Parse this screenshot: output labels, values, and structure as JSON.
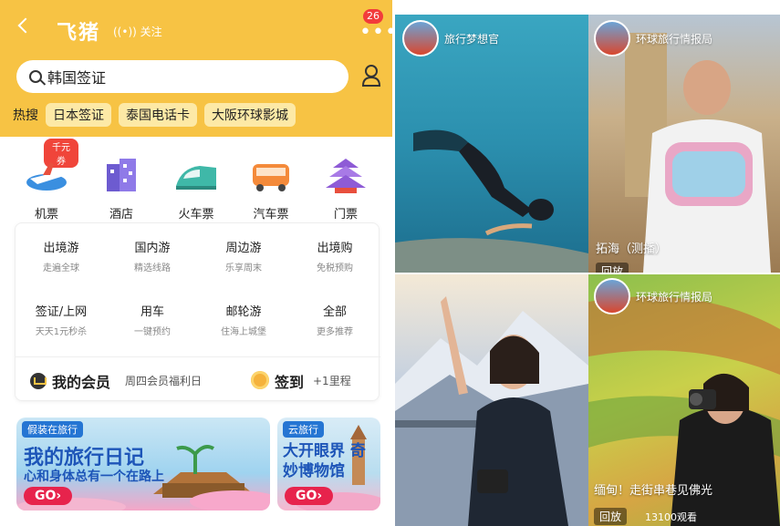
{
  "app": {
    "brand": "飞猪",
    "follow": "关注",
    "badge": "26",
    "more": "•••",
    "search_value": "韩国签证",
    "hot_label": "热搜",
    "hot_tags": [
      "日本签证",
      "泰国电话卡",
      "大阪环球影城"
    ]
  },
  "categories": [
    {
      "label": "机票",
      "promo": "千元券",
      "icon": "plane-icon"
    },
    {
      "label": "酒店",
      "icon": "hotel-icon"
    },
    {
      "label": "火车票",
      "icon": "train-icon"
    },
    {
      "label": "汽车票",
      "icon": "bus-icon"
    },
    {
      "label": "门票",
      "icon": "temple-icon"
    }
  ],
  "grid": [
    {
      "title": "出境游",
      "sub": "走遍全球"
    },
    {
      "title": "国内游",
      "sub": "精选线路"
    },
    {
      "title": "周边游",
      "sub": "乐享周末"
    },
    {
      "title": "出境购",
      "sub": "免税预购"
    },
    {
      "title": "签证/上网",
      "sub": "天天1元秒杀"
    },
    {
      "title": "用车",
      "sub": "一键预约"
    },
    {
      "title": "邮轮游",
      "sub": "住海上城堡"
    },
    {
      "title": "全部",
      "sub": "更多推荐"
    }
  ],
  "member": {
    "title": "我的会员",
    "sub": "周四会员福利日",
    "sign_title": "签到",
    "sign_sub": "+1里程"
  },
  "banners": [
    {
      "tag": "假装在旅行",
      "title": "我的旅行日记",
      "sub": "心和身体总有一个在路上",
      "go": "GO›"
    },
    {
      "tag": "云旅行",
      "title": "大开眼界 奇妙博物馆",
      "go": "GO›"
    }
  ],
  "videos": [
    {
      "account": "旅行梦想官"
    },
    {
      "account": "环球旅行情报局",
      "caption": "拓海（测播）",
      "replay": "回放"
    },
    {},
    {
      "account": "环球旅行情报局",
      "caption": "缅甸！走街串巷见佛光",
      "replay": "回放",
      "views": "13100观看"
    }
  ],
  "colors": {
    "brand_yellow": "#f7c344",
    "go_red": "#e7234c",
    "banner_blue": "#1d55b8"
  }
}
